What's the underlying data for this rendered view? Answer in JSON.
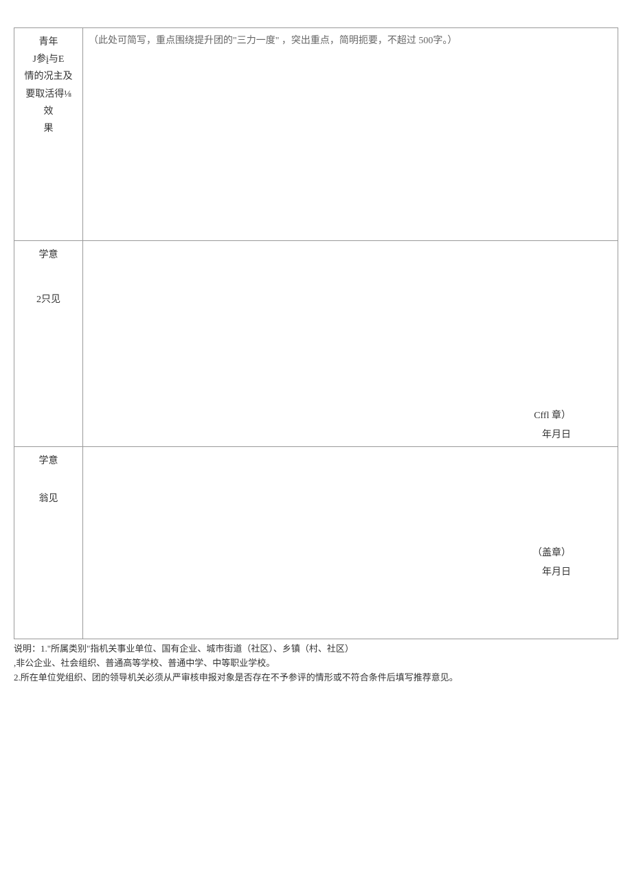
{
  "row1": {
    "label_line1": "青年",
    "label_line2": "J参į与E",
    "label_line3": "情的况主及",
    "label_line4": "要取活得⅛",
    "label_line5": "效",
    "label_line6": "果",
    "hint": "（此处可简写，重点围绕提升团的\"三力一度\" ，突出重点，简明扼要，不超过 500字。）"
  },
  "row2": {
    "label_line1": "学意",
    "label_line2": "2只见",
    "stamp": "Cffl 章）",
    "date": "年月日"
  },
  "row3": {
    "label_line1": "学意",
    "label_line2": "翁见",
    "stamp": "（盖章）",
    "date": "年月日"
  },
  "notes": {
    "line1": "说明：1.\"所属类别\"指机关事业单位、国有企业、城市街道（社区）、乡镇（村、社区）",
    "line2": ",非公企业、社会组织、普通高等学校、普通中学、中等职业学校。",
    "line3": "2.所在单位党组织、团的领导机关必须从严审核申报对象是否存在不予参评的情形或不符合条件后填写推荐意见。"
  }
}
